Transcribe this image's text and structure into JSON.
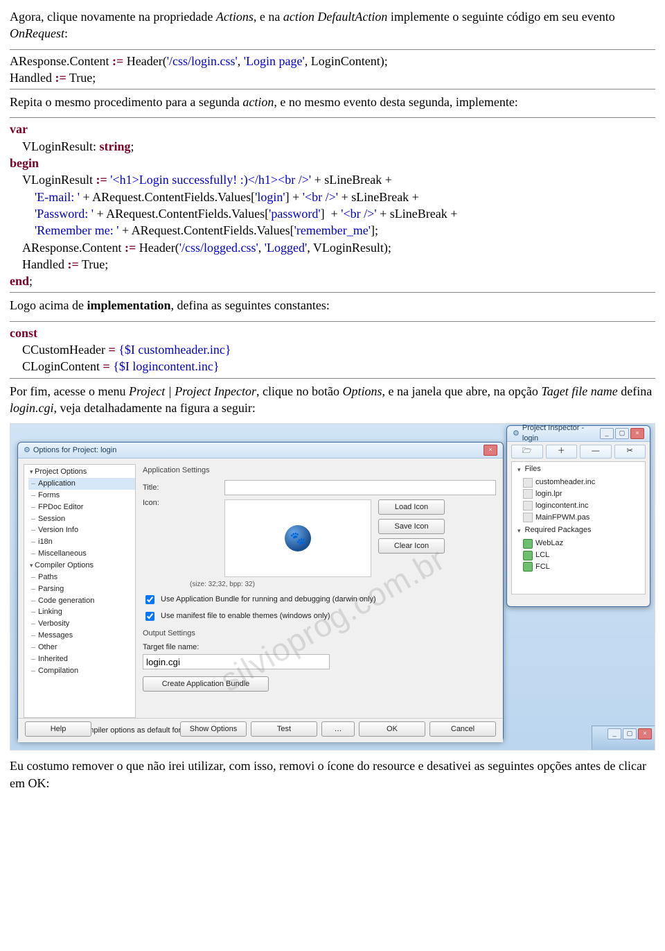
{
  "para1_a": "Agora, clique novamente na propriedade ",
  "para1_b": "Actions",
  "para1_c": ", e na ",
  "para1_d": "action",
  "para1_e": " ",
  "para1_f": "DefaultAction",
  "para1_g": " implemente o seguinte código em seu evento ",
  "para1_h": "OnRequest",
  "para1_i": ":",
  "code1": {
    "l1a": "AResponse.Content ",
    "l1b": ":=",
    "l1c": " Header(",
    "l1d": "'/css/login.css'",
    "l1e": ", ",
    "l1f": "'Login page'",
    "l1g": ", LoginContent);",
    "l2a": "Handled ",
    "l2b": ":=",
    "l2c": " True;"
  },
  "para2_a": "Repita o mesmo procedimento para a segunda ",
  "para2_b": "action",
  "para2_c": ", e no mesmo evento desta segunda, implemente:",
  "code2": {
    "kw_var": "var",
    "var_line": "    VLoginResult: ",
    "type_string": "string",
    "semi": ";",
    "kw_begin": "begin",
    "l1a": "    VLoginResult ",
    "l1b": ":=",
    "l1c": " ",
    "l1d": "'<h1>Login successfully! :)</h1><br />'",
    "l1e": " + sLineBreak +",
    "l2a": "        ",
    "l2b": "'E-mail: '",
    "l2c": " + ARequest.ContentFields.Values[",
    "l2d": "'login'",
    "l2e": "] + ",
    "l2f": "'<br />'",
    "l2g": " + sLineBreak +",
    "l3a": "        ",
    "l3b": "'Password: '",
    "l3c": " + ARequest.ContentFields.Values[",
    "l3d": "'password'",
    "l3e": "]  + ",
    "l3f": "'<br />'",
    "l3g": " + sLineBreak +",
    "l4a": "        ",
    "l4b": "'Remember me: '",
    "l4c": " + ARequest.ContentFields.Values[",
    "l4d": "'remember_me'",
    "l4e": "];",
    "l5a": "    AResponse.Content ",
    "l5b": ":=",
    "l5c": " Header(",
    "l5d": "'/css/logged.css'",
    "l5e": ", ",
    "l5f": "'Logged'",
    "l5g": ", VLoginResult);",
    "l6a": "    Handled ",
    "l6b": ":=",
    "l6c": " True;",
    "kw_end": "end",
    "end_semi": ";"
  },
  "para3_a": "Logo acima de ",
  "para3_b": "implementation",
  "para3_c": ", defina as seguintes constantes:",
  "code3": {
    "kw_const": "const",
    "l1a": "    CCustomHeader ",
    "l1b": "=",
    "l1c": " ",
    "l1d": "{$I customheader.inc}",
    "l2a": "    CLoginContent ",
    "l2b": "=",
    "l2c": " ",
    "l2d": "{$I logincontent.inc}"
  },
  "para4_a": "Por fim, acesse o menu ",
  "para4_b": "Project | Project Inpector",
  "para4_c": ", clique no botão ",
  "para4_d": "Options",
  "para4_e": ", e na janela que abre, na opção ",
  "para4_f": "Taget file name",
  "para4_g": " defina ",
  "para4_h": "login.cgi",
  "para4_i": ", veja detalhadamente na figura a seguir:",
  "shot": {
    "opt_title": "Options for Project: login",
    "tree": {
      "project_options": "Project Options",
      "application": "Application",
      "forms": "Forms",
      "fpdoc": "FPDoc Editor",
      "session": "Session",
      "version": "Version Info",
      "i18n": "i18n",
      "misc": "Miscellaneous",
      "compiler_options": "Compiler Options",
      "paths": "Paths",
      "parsing": "Parsing",
      "codegen": "Code generation",
      "linking": "Linking",
      "verbosity": "Verbosity",
      "messages": "Messages",
      "other": "Other",
      "inherited": "Inherited",
      "compilation": "Compilation"
    },
    "app_settings": "Application Settings",
    "title_lbl": "Title:",
    "icon_lbl": "Icon:",
    "load_icon": "Load Icon",
    "save_icon": "Save Icon",
    "clear_icon": "Clear Icon",
    "size_info": "(size: 32;32, bpp: 32)",
    "chk_bundle": "Use Application Bundle for running and debugging (darwin only)",
    "chk_manifest": "Use manifest file to enable themes (windows only)",
    "output_settings": "Output Settings",
    "target_label": "Target file name:",
    "target_value": "login.cgi",
    "create_bundle": "Create Application Bundle",
    "chk_default": "Use these compiler options as default for new projects",
    "btn_help": "Help",
    "btn_show": "Show Options",
    "btn_test": "Test",
    "btn_dots": "…",
    "btn_ok": "OK",
    "btn_cancel": "Cancel",
    "pi_title": "Project Inspector - login",
    "pi_open": "🗁",
    "pi_add": "＋",
    "pi_remove": "—",
    "pi_opts": "✂",
    "files": "Files",
    "f_customheader": "customheader.inc",
    "f_loginlpr": "login.lpr",
    "f_logincontent": "logincontent.inc",
    "f_mainfpwm": "MainFPWM.pas",
    "req_packages": "Required Packages",
    "p_weblaz": "WebLaz",
    "p_lcl": "LCL",
    "p_fcl": "FCL",
    "watermark": "silvioprog.com.br"
  },
  "para5": "Eu costumo remover o que não irei utilizar, com isso, removi o ícone do resource e desativei as seguintes opções antes de clicar em OK:"
}
